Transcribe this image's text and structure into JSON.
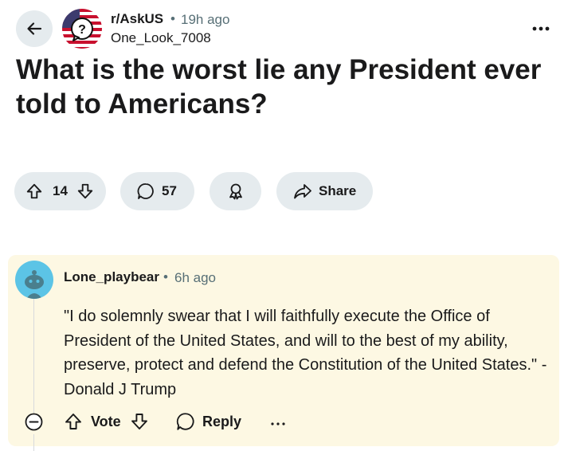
{
  "post": {
    "subreddit": "r/AskUS",
    "separator": "•",
    "time": "19h ago",
    "author": "One_Look_7008",
    "title": "What is the worst lie any President ever told to Americans?",
    "upvotes": "14",
    "comments": "57",
    "share_label": "Share"
  },
  "comment": {
    "author": "Lone_playbear",
    "separator": "•",
    "time": "6h ago",
    "body": "\"I do solemnly swear that I will faithfully execute the Office of President of the United States, and will to the best of my ability, preserve, protect and defend the Constitution of the United States.\" -Donald J Trump",
    "vote_label": "Vote",
    "reply_label": "Reply"
  },
  "colors": {
    "pill_bg": "#e5ebee",
    "comment_highlight": "#fdf8e3",
    "meta_gray": "#576f76",
    "avatar_teal": "#5cc4e6"
  },
  "icons": [
    "back-arrow-icon",
    "more-options-icon",
    "upvote-icon",
    "downvote-icon",
    "comment-bubble-icon",
    "award-icon",
    "share-arrow-icon",
    "collapse-icon",
    "reply-bubble-icon"
  ]
}
